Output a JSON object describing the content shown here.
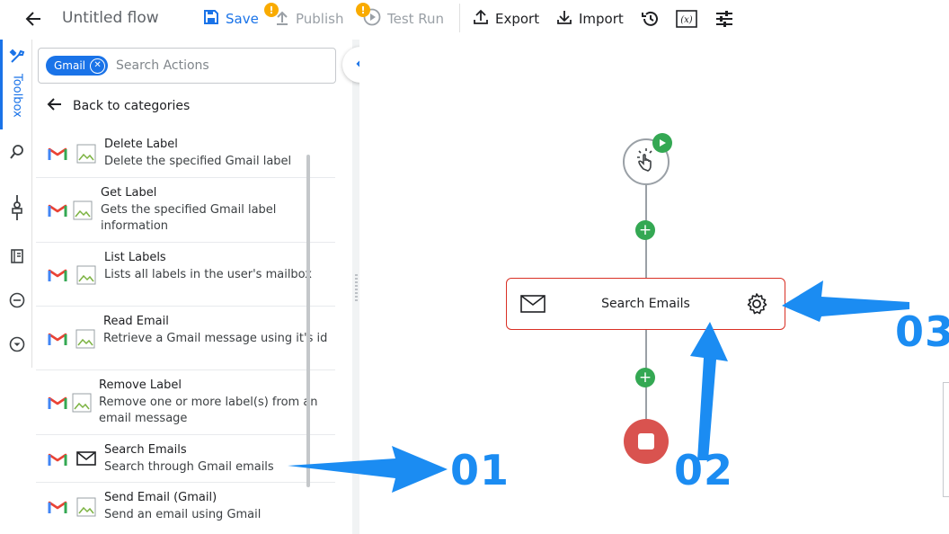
{
  "header": {
    "title": "Untitled flow",
    "save_label": "Save",
    "publish_label": "Publish",
    "test_run_label": "Test Run",
    "export_label": "Export",
    "import_label": "Import",
    "warning_symbol": "!"
  },
  "sidebar": {
    "toolbox_label": "Toolbox",
    "icons": [
      "toolbox-icon",
      "search-icon",
      "connector-icon",
      "notebook-icon",
      "minus-circle-icon",
      "chevron-circle-icon"
    ]
  },
  "panel": {
    "filter_chip": "Gmail",
    "search_placeholder": "Search Actions",
    "back_label": "Back to categories",
    "items": [
      {
        "title": "Delete Label",
        "desc": "Delete the specified Gmail label"
      },
      {
        "title": "Get Label",
        "desc": "Gets the specified Gmail label information"
      },
      {
        "title": "List Labels",
        "desc": "Lists all labels in the user's mailbox"
      },
      {
        "title": "Read Email",
        "desc": "Retrieve a Gmail message using it's id"
      },
      {
        "title": "Remove Label",
        "desc": "Remove one or more label(s) from an email message"
      },
      {
        "title": "Search Emails",
        "desc": "Search through Gmail emails"
      },
      {
        "title": "Send Email (Gmail)",
        "desc": "Send an email using Gmail"
      }
    ]
  },
  "canvas": {
    "action_node_label": "Search Emails",
    "add_symbol": "+"
  },
  "annotations": {
    "label_1": "01",
    "label_2": "02",
    "label_3": "03",
    "color": "#1b8cf2"
  },
  "colors": {
    "primary": "#1a73e8",
    "success": "#34a853",
    "danger": "#d93025",
    "warning": "#f9ab00"
  }
}
